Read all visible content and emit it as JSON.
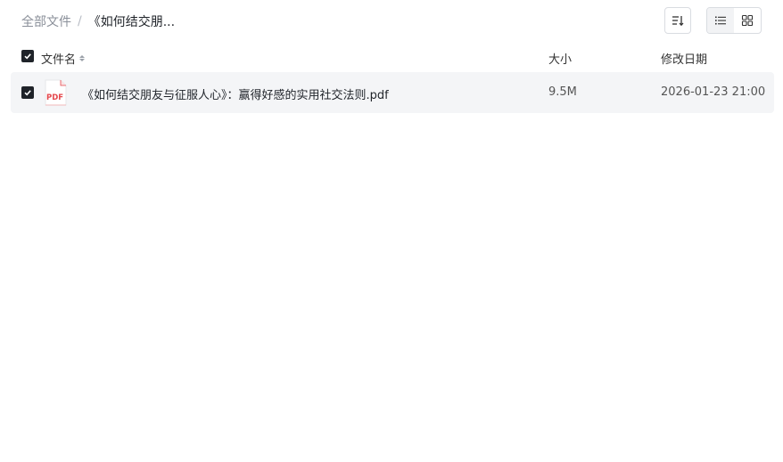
{
  "breadcrumb": {
    "root": "全部文件",
    "separator": "/",
    "current": "《如何结交朋..."
  },
  "toolbar": {
    "sort_icon": "sort-list-icon",
    "view_list_icon": "list-view-icon",
    "view_grid_icon": "grid-view-icon",
    "active_view": "list"
  },
  "table": {
    "columns": [
      "文件名",
      "大小",
      "修改日期"
    ],
    "header_checked": true,
    "rows": [
      {
        "checked": true,
        "icon": "pdf-icon",
        "icon_label": "PDF",
        "name": "《如何结交朋友与征服人心》：赢得好感的实用社交法则.pdf",
        "size": "9.5M",
        "modified": "2026-01-23 21:00"
      }
    ]
  },
  "colors": {
    "checkbox": "#1f2329",
    "row_selected_bg": "#f4f5f7",
    "pdf_red": "#e5484d"
  }
}
